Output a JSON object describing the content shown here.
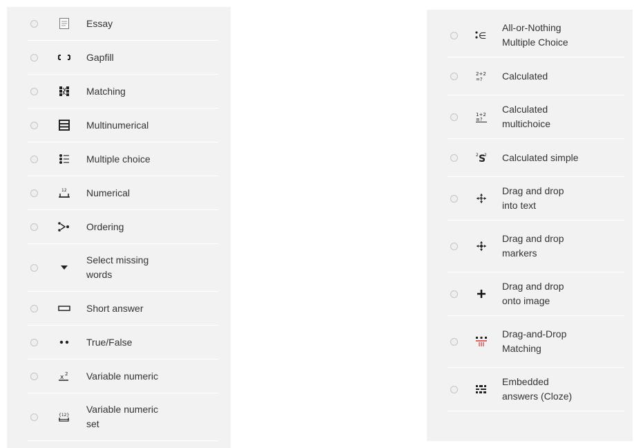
{
  "left_list": [
    {
      "label": "Essay",
      "icon": "essay-icon"
    },
    {
      "label": "Gapfill",
      "icon": "gapfill-icon"
    },
    {
      "label": "Matching",
      "icon": "matching-icon"
    },
    {
      "label": "Multinumerical",
      "icon": "multinumerical-icon"
    },
    {
      "label": "Multiple choice",
      "icon": "multiple-choice-icon"
    },
    {
      "label": "Numerical",
      "icon": "numerical-icon"
    },
    {
      "label": "Ordering",
      "icon": "ordering-icon"
    },
    {
      "label": "Select missing words",
      "icon": "select-missing-words-icon",
      "lines": [
        "Select missing",
        "words"
      ]
    },
    {
      "label": "Short answer",
      "icon": "short-answer-icon"
    },
    {
      "label": "True/False",
      "icon": "true-false-icon"
    },
    {
      "label": "Variable numeric",
      "icon": "variable-numeric-icon"
    },
    {
      "label": "Variable numeric set",
      "icon": "variable-numeric-set-icon",
      "lines": [
        "Variable numeric",
        "set"
      ]
    }
  ],
  "right_list": [
    {
      "label": "All-or-Nothing Multiple Choice",
      "icon": "all-or-nothing-icon",
      "lines": [
        "All-or-Nothing",
        "Multiple Choice"
      ]
    },
    {
      "label": "Calculated",
      "icon": "calculated-icon"
    },
    {
      "label": "Calculated multichoice",
      "icon": "calculated-multichoice-icon",
      "lines": [
        "Calculated",
        "multichoice"
      ]
    },
    {
      "label": "Calculated simple",
      "icon": "calculated-simple-icon"
    },
    {
      "label": "Drag and drop into text",
      "icon": "drag-drop-text-icon",
      "lines": [
        "Drag and drop",
        "into text"
      ]
    },
    {
      "label": "Drag and drop markers",
      "icon": "drag-drop-markers-icon",
      "lines": [
        "Drag and drop",
        "markers"
      ]
    },
    {
      "label": "Drag and drop onto image",
      "icon": "drag-drop-image-icon",
      "lines": [
        "Drag and drop",
        "onto image"
      ]
    },
    {
      "label": "Drag-and-Drop Matching",
      "icon": "drag-drop-matching-icon",
      "lines": [
        "Drag-and-Drop",
        "Matching"
      ]
    },
    {
      "label": "Embedded answers (Cloze)",
      "icon": "embedded-answers-icon",
      "lines": [
        "Embedded",
        "answers (Cloze)"
      ]
    }
  ]
}
